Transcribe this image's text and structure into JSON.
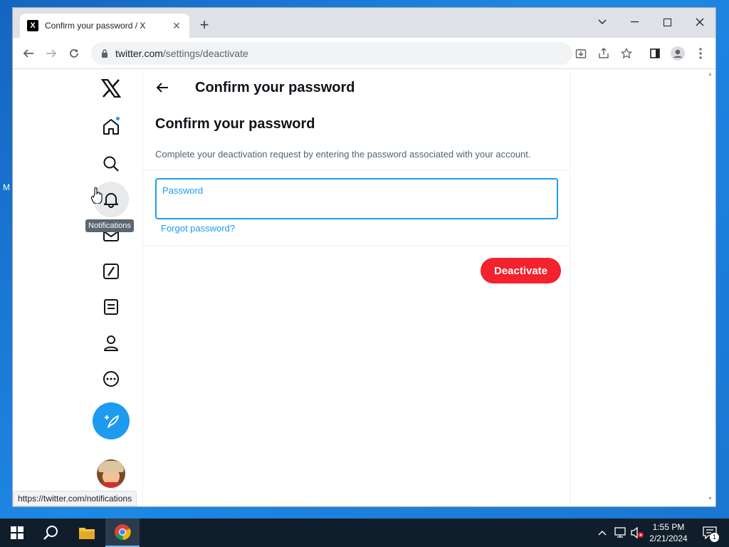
{
  "browser": {
    "tab_title": "Confirm your password / X",
    "tab_favicon": "X",
    "url_domain": "twitter.com",
    "url_path": "/settings/deactivate"
  },
  "sidebar": {
    "tooltip": "Notifications"
  },
  "main": {
    "header_title": "Confirm your password",
    "section_title": "Confirm your password",
    "description": "Complete your deactivation request by entering the password associated with your account.",
    "password_label": "Password",
    "password_value": "",
    "forgot_link": "Forgot password?",
    "deactivate_label": "Deactivate"
  },
  "status_bar": {
    "hover_url": "https://twitter.com/notifications"
  },
  "taskbar": {
    "time": "1:55 PM",
    "date": "2/21/2024",
    "notification_count": "1"
  },
  "colors": {
    "accent": "#1d9bf0",
    "danger": "#f4212e",
    "taskbar": "#101d2b"
  }
}
